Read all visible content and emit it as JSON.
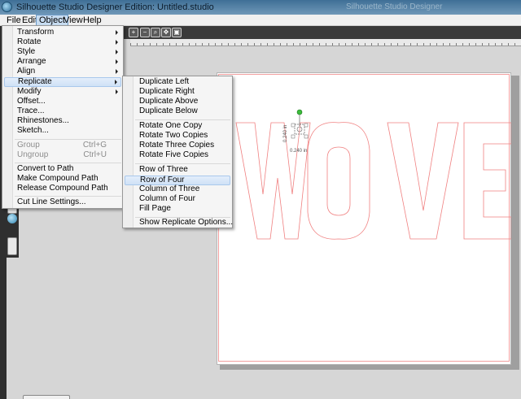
{
  "window": {
    "title": "Silhouette Studio Designer Edition: Untitled.studio",
    "ghost_text": "Silhouette Studio Designer"
  },
  "menubar": [
    {
      "id": "file",
      "label": "File"
    },
    {
      "id": "edit",
      "label": "Edit"
    },
    {
      "id": "object",
      "label": "Object",
      "active": true
    },
    {
      "id": "view",
      "label": "View"
    },
    {
      "id": "help",
      "label": "Help"
    }
  ],
  "object_menu": {
    "items": [
      {
        "label": "Transform",
        "submenu": true
      },
      {
        "label": "Rotate",
        "submenu": true
      },
      {
        "label": "Style",
        "submenu": true
      },
      {
        "label": "Arrange",
        "submenu": true
      },
      {
        "label": "Align",
        "submenu": true
      },
      {
        "label": "Replicate",
        "submenu": true,
        "highlighted": true
      },
      {
        "label": "Modify",
        "submenu": true
      },
      {
        "label": "Offset..."
      },
      {
        "label": "Trace..."
      },
      {
        "label": "Rhinestones..."
      },
      {
        "label": "Sketch..."
      },
      {
        "label": "Group",
        "shortcut": "Ctrl+G",
        "disabled": true
      },
      {
        "label": "Ungroup",
        "shortcut": "Ctrl+U",
        "disabled": true
      },
      {
        "label": "Convert to Path"
      },
      {
        "label": "Make Compound Path"
      },
      {
        "label": "Release Compound Path"
      },
      {
        "label": "Cut Line Settings..."
      }
    ]
  },
  "replicate_menu": {
    "items": [
      {
        "label": "Duplicate Left"
      },
      {
        "label": "Duplicate Right"
      },
      {
        "label": "Duplicate Above"
      },
      {
        "label": "Duplicate Below"
      },
      {
        "label": "Rotate One Copy"
      },
      {
        "label": "Rotate Two Copies"
      },
      {
        "label": "Rotate Three Copies"
      },
      {
        "label": "Rotate Five Copies"
      },
      {
        "label": "Row of Three"
      },
      {
        "label": "Row of Four",
        "highlighted": true
      },
      {
        "label": "Column of Three"
      },
      {
        "label": "Column of Four"
      },
      {
        "label": "Fill Page"
      },
      {
        "label": "Show Replicate Options..."
      }
    ]
  },
  "canvas": {
    "text": "WOVE",
    "outline_color": "#f08080",
    "selection": {
      "width_label": "0.240 in",
      "height_label": "0.240 in"
    }
  },
  "toolbar_icons": [
    "zoom-in-icon",
    "zoom-out-icon",
    "zoom-select-icon",
    "pan-icon",
    "fit-page-icon"
  ]
}
